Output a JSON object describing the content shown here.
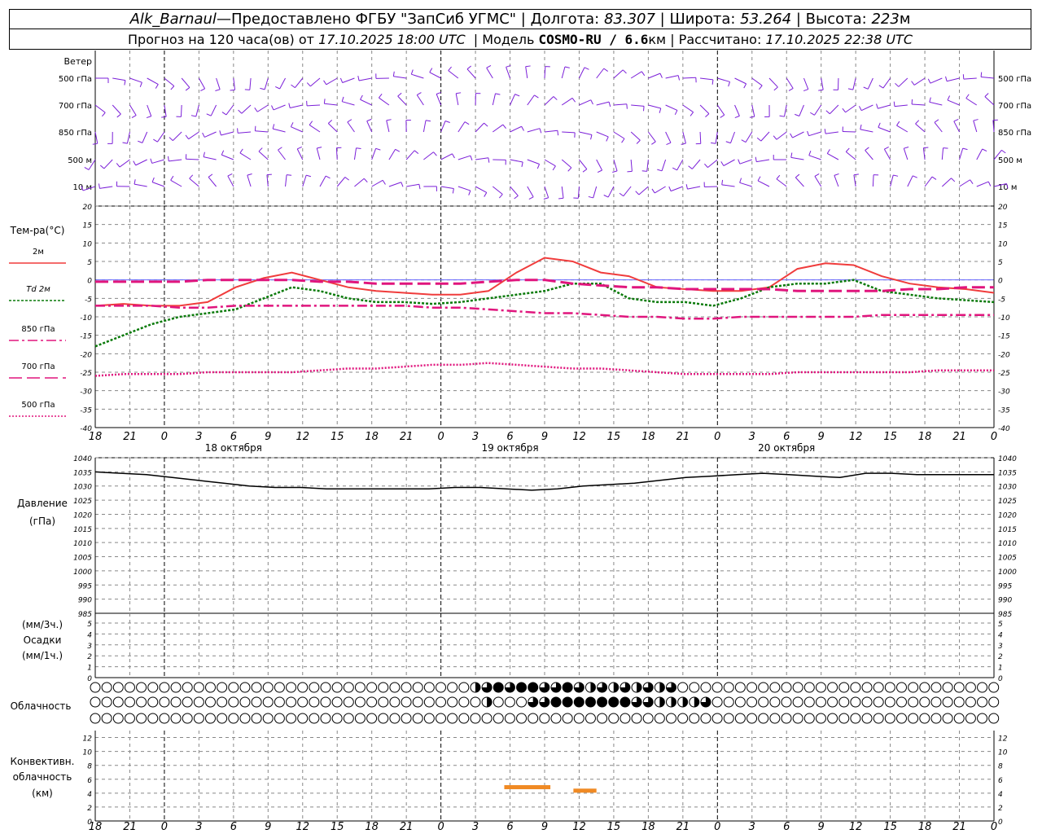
{
  "header": {
    "station": "Alk_Barnaul",
    "dash": " — ",
    "provider": "Предоставлено ФГБУ \"ЗапСиб УГМС\"",
    "lon_label": "Долгота:",
    "lon_value": "83.307",
    "lat_label": "Широта:",
    "lat_value": "53.264",
    "alt_label": "Высота:",
    "alt_value": "223",
    "alt_unit": "м",
    "forecast_label": "Прогноз на 120 часа(ов) от",
    "forecast_start": "17.10.2025 18:00 UTC",
    "model_label": "Модель",
    "model_name": "COSMO-RU / 6.6",
    "model_unit": "км",
    "calc_label": "Рассчитано:",
    "calc_value": "17.10.2025 22:38 UTC"
  },
  "labels": {
    "wind": "Ветер",
    "wind_levels": [
      "500 гПа",
      "700 гПа",
      "850 гПа",
      "500 м",
      "10  м"
    ],
    "temp_title": "Тем-ра(°C)",
    "legend": [
      "2м",
      "Td  2м",
      "850 гПа",
      "700 гПа",
      "500 гПа"
    ],
    "pressure_title": "Давление",
    "pressure_unit": "(гПа)",
    "precip_unit_1": "(мм/3ч.)",
    "precip_title": "Осадки",
    "precip_unit_2": "(мм/1ч.)",
    "cloud_title": "Облачность",
    "conv_title_1": "Конвективн.",
    "conv_title_2": "облачность",
    "conv_unit": "(км)"
  },
  "time_axis": {
    "ticks": [
      "18",
      "21",
      "0",
      "3",
      "6",
      "9",
      "12",
      "15",
      "18",
      "21",
      "0",
      "3",
      "6",
      "9",
      "12",
      "15",
      "18",
      "21",
      "0",
      "3",
      "6",
      "9",
      "12",
      "15",
      "18",
      "21",
      "0"
    ],
    "dates": [
      "18 октября",
      "19 октября",
      "20 октября"
    ]
  },
  "colors": {
    "wind": "#7b1fd8",
    "t2m": "#f03c3c",
    "td2m": "#0a7a0a",
    "t850": "#e0157d",
    "t700": "#e0157d",
    "t500": "#e0157d",
    "pressure": "#000000",
    "convective": "#f08a24",
    "grid": "#888888"
  },
  "chart_data": [
    {
      "type": "line",
      "name": "temperature",
      "x_hours": [
        0,
        3,
        6,
        9,
        12,
        15,
        18,
        21,
        24,
        27,
        30,
        33,
        36,
        39,
        42,
        45,
        48,
        51,
        54,
        57,
        60,
        63,
        66,
        69,
        72,
        75,
        78
      ],
      "ylim": [
        -40,
        20
      ],
      "yticks": [
        20,
        15,
        10,
        5,
        0,
        -5,
        -10,
        -15,
        -20,
        -25,
        -30,
        -35,
        -40
      ],
      "series": [
        {
          "name": "2м",
          "values": [
            -7,
            -6.5,
            -7,
            -7,
            -6,
            -2,
            0.5,
            2,
            0,
            -2,
            -3,
            -3.5,
            -4,
            -4,
            -3,
            2,
            6,
            5,
            2,
            1,
            -2,
            -2.5,
            -3,
            -3,
            -2,
            3,
            4.5,
            4,
            1,
            -1,
            -2,
            -2.5,
            -3.5
          ]
        },
        {
          "name": "Td 2м",
          "values": [
            -18,
            -15,
            -12,
            -10,
            -9,
            -8,
            -5,
            -2,
            -3,
            -5,
            -6,
            -6,
            -6.5,
            -6,
            -5,
            -4,
            -3,
            -1,
            -1,
            -5,
            -6,
            -6,
            -7,
            -5,
            -2,
            -1,
            -1,
            0,
            -3,
            -4,
            -5,
            -5.5,
            -6
          ]
        },
        {
          "name": "850 гПа",
          "values": [
            -7,
            -7,
            -7,
            -7.5,
            -7.5,
            -7,
            -7,
            -7,
            -7,
            -7,
            -7,
            -7,
            -7.5,
            -7.5,
            -8,
            -8.5,
            -9,
            -9,
            -9.5,
            -10,
            -10,
            -10.5,
            -10.5,
            -10,
            -10,
            -10,
            -10,
            -10,
            -9.5,
            -9.5,
            -9.5,
            -9.5,
            -9.5
          ]
        },
        {
          "name": "700 гПа",
          "values": [
            -0.5,
            -0.5,
            -0.5,
            -0.5,
            0,
            0,
            0,
            0,
            -0.5,
            -0.5,
            -1,
            -1,
            -1,
            -1,
            -0.5,
            0,
            0,
            -1,
            -1.5,
            -2,
            -2,
            -2.5,
            -2.5,
            -2.5,
            -2.5,
            -3,
            -3,
            -3,
            -3,
            -2.5,
            -2.5,
            -2,
            -2
          ]
        },
        {
          "name": "500 гПа",
          "values": [
            -26,
            -25.5,
            -25.5,
            -25.5,
            -25,
            -25,
            -25,
            -25,
            -24.5,
            -24,
            -24,
            -23.5,
            -23,
            -23,
            -22.5,
            -23,
            -23.5,
            -24,
            -24,
            -24.5,
            -25,
            -25.5,
            -25.5,
            -25.5,
            -25.5,
            -25,
            -25,
            -25,
            -25,
            -25,
            -24.5,
            -24.5,
            -24.5
          ]
        }
      ]
    },
    {
      "type": "line",
      "name": "pressure",
      "ylim": [
        985,
        1040
      ],
      "yticks": [
        1040,
        1035,
        1030,
        1025,
        1020,
        1015,
        1010,
        1005,
        1000,
        995,
        990,
        985
      ],
      "series": [
        {
          "name": "Давление",
          "values": [
            1035,
            1034.5,
            1034,
            1033,
            1032,
            1031,
            1030,
            1029.5,
            1029.5,
            1029,
            1029,
            1029,
            1029,
            1029,
            1029.5,
            1029.5,
            1029,
            1028.5,
            1029,
            1030,
            1030.5,
            1031,
            1032,
            1033,
            1033.5,
            1034,
            1034.5,
            1034,
            1033.5,
            1033,
            1034.5,
            1034.5,
            1034,
            1034,
            1034,
            1034
          ]
        }
      ]
    },
    {
      "type": "bar",
      "name": "precipitation",
      "ylim": [
        0,
        5
      ],
      "yticks": [
        5,
        4,
        3,
        2,
        1,
        0
      ],
      "values": []
    },
    {
      "type": "heatmap",
      "name": "cloudiness",
      "rows": [
        "0000000000000000000000000000000000000000000000000000000000000000000000000000000000000000000000",
        "0000000000000000000000000000000000000000000000000000000000000000000000000000000000000000000000",
        "0000000000000000000000000000000000000000000000000000000000000000000000000000000000000000000000"
      ],
      "upper_levels_cover": [
        0,
        0,
        0,
        0,
        0,
        0,
        0,
        0,
        0,
        0,
        0,
        0,
        0,
        0,
        0,
        0,
        0,
        0,
        0,
        0,
        0,
        0,
        0,
        0,
        0,
        0,
        0,
        0,
        0,
        0,
        0,
        0,
        0,
        2,
        3,
        4,
        3,
        4,
        4,
        3,
        3,
        4,
        3,
        2,
        3,
        2,
        3,
        2,
        3,
        2,
        3,
        0,
        0,
        0,
        0,
        0,
        0,
        0,
        0,
        0,
        0,
        0,
        0,
        0,
        0,
        0,
        0,
        0,
        0,
        0,
        0,
        0,
        0,
        0,
        0,
        0,
        0,
        0,
        0,
        0,
        0,
        0,
        0,
        0,
        0,
        0,
        0,
        0,
        0,
        0,
        0,
        0,
        3,
        3,
        2,
        3,
        2,
        2,
        2,
        2,
        2,
        2,
        2,
        2
      ],
      "middle_levels_cover": [
        0,
        0,
        0,
        0,
        0,
        0,
        0,
        0,
        0,
        0,
        0,
        0,
        0,
        0,
        0,
        0,
        0,
        0,
        0,
        0,
        0,
        0,
        0,
        0,
        0,
        0,
        0,
        0,
        0,
        0,
        0,
        0,
        0,
        0,
        2,
        0,
        0,
        0,
        3,
        3,
        4,
        4,
        4,
        4,
        4,
        4,
        4,
        3,
        3,
        2,
        2,
        2,
        2,
        3,
        0,
        0,
        0,
        0,
        0,
        0,
        0,
        0,
        0,
        0,
        0,
        0,
        0,
        0,
        0,
        0,
        0,
        0,
        0,
        0,
        0,
        0,
        0,
        0,
        0,
        0,
        0,
        0,
        0,
        0,
        0,
        0,
        0,
        0,
        0,
        0,
        0,
        0,
        3,
        3,
        0,
        0,
        0,
        0,
        0,
        0,
        0,
        0,
        3
      ]
    },
    {
      "type": "bar",
      "name": "convective_cloud",
      "ylim": [
        0,
        13
      ],
      "yticks": [
        12,
        10,
        8,
        6,
        4,
        2,
        0
      ],
      "segments": [
        {
          "from_hour": 35.5,
          "to_hour": 39.5,
          "top_km": 4.8
        },
        {
          "from_hour": 41.5,
          "to_hour": 43.5,
          "top_km": 4.3
        }
      ]
    }
  ]
}
